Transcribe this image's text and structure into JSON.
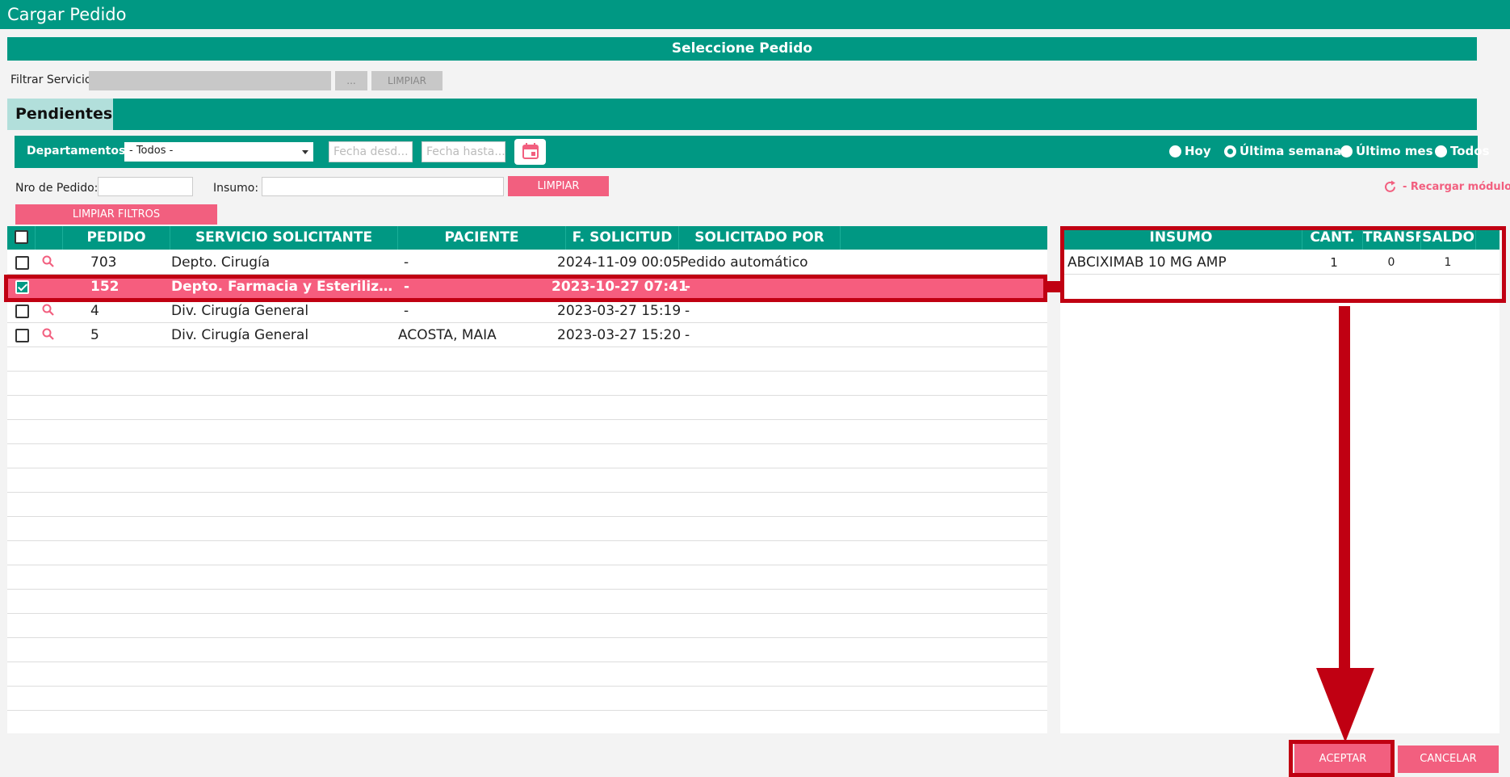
{
  "window": {
    "title": "Cargar Pedido"
  },
  "section": {
    "title": "Seleccione Pedido"
  },
  "service_filter": {
    "label": "Filtrar Servicio",
    "value": "",
    "browse_label": "...",
    "clear_label": "LIMPIAR"
  },
  "tabs": [
    {
      "label": "Pendientes",
      "active": true
    }
  ],
  "filters": {
    "departamentos_label": "Departamentos",
    "departamentos_value": "- Todos -",
    "fecha_desde_placeholder": "Fecha desd...",
    "fecha_hasta_placeholder": "Fecha hasta...",
    "calendar_icon": "calendar-icon",
    "period_options": [
      {
        "label": "Hoy",
        "selected": false
      },
      {
        "label": "Última semana",
        "selected": true
      },
      {
        "label": "Último mes",
        "selected": false
      },
      {
        "label": "Todos",
        "selected": false
      }
    ],
    "nro_pedido_label": "Nro de Pedido:",
    "nro_pedido_value": "",
    "insumo_label": "Insumo:",
    "insumo_value": "",
    "limpiar_label": "LIMPIAR",
    "limpiar_filtros_label": "LIMPIAR FILTROS",
    "reload_label": "- Recargar módulo"
  },
  "orders_table": {
    "columns": [
      "PEDIDO",
      "SERVICIO SOLICITANTE",
      "PACIENTE",
      "F. SOLICITUD",
      "SOLICITADO POR"
    ],
    "rows": [
      {
        "checked": false,
        "pedido": "703",
        "servicio": "Depto. Cirugía",
        "paciente": "-",
        "fecha": "2024-11-09 00:05",
        "solicitado_por": "Pedido automático"
      },
      {
        "checked": true,
        "pedido": "152",
        "servicio": "Depto. Farmacia y Esteriliza...",
        "paciente": "-",
        "fecha": "2023-10-27 07:41",
        "solicitado_por": "-"
      },
      {
        "checked": false,
        "pedido": "4",
        "servicio": "Div. Cirugía General",
        "paciente": "-",
        "fecha": "2023-03-27 15:19",
        "solicitado_por": "-"
      },
      {
        "checked": false,
        "pedido": "5",
        "servicio": "Div. Cirugía General",
        "paciente": "ACOSTA, MAIA",
        "fecha": "2023-03-27 15:20",
        "solicitado_por": "-"
      }
    ]
  },
  "items_table": {
    "columns": [
      "INSUMO",
      "CANT.",
      "TRANSF.",
      "SALDO"
    ],
    "rows": [
      {
        "insumo": "ABCIXIMAB 10 MG AMP",
        "cant": "1",
        "transf": "0",
        "saldo": "1"
      }
    ]
  },
  "footer": {
    "accept_label": "ACEPTAR",
    "cancel_label": "CANCELAR"
  },
  "colors": {
    "primary": "#009883",
    "accent": "#f25f7f",
    "annotation": "#c00012"
  }
}
